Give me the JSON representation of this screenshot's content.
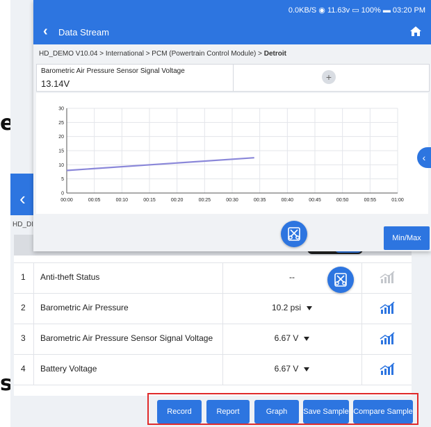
{
  "statusbar": {
    "text": "0.0KB/S  ◉  11.63v  ▭  100%  ▬  03:20 PM"
  },
  "title": "Data Stream",
  "breadcrumb": {
    "path": "HD_DEMO V10.04 > International > PCM (Powertrain Control Module) > ",
    "current": "Detroit"
  },
  "sensor": {
    "name": "Barometric Air Pressure Sensor Signal Voltage",
    "value": "13.14V",
    "add_label": "+"
  },
  "chart_data": {
    "type": "line",
    "title": "",
    "xlabel": "",
    "ylabel": "",
    "x_ticks": [
      "00:00",
      "00:05",
      "00:10",
      "00:15",
      "00:20",
      "00:25",
      "00:30",
      "00:35",
      "00:40",
      "00:45",
      "00:50",
      "00:55",
      "01:00"
    ],
    "y_ticks": [
      0,
      5,
      10,
      15,
      20,
      25,
      30
    ],
    "xlim": [
      0,
      60
    ],
    "ylim": [
      0,
      30
    ],
    "grid": true,
    "series": [
      {
        "color": "#8a87d9",
        "x": [
          0,
          34
        ],
        "y": [
          8.0,
          12.5
        ]
      }
    ]
  },
  "minmax_label": "Min/Max",
  "edge_letters": [
    "e",
    "s"
  ],
  "background": {
    "breadcrumb": "HD_DI",
    "rows": [
      {
        "num": "1",
        "name": "Anti-theft Status",
        "value": "--",
        "unit": "",
        "has_caret": false,
        "graph_active": false
      },
      {
        "num": "2",
        "name": "Barometric Air Pressure",
        "value": "10.2",
        "unit": "psi",
        "has_caret": true,
        "graph_active": true
      },
      {
        "num": "3",
        "name": "Barometric Air Pressure Sensor Signal Voltage",
        "value": "6.67",
        "unit": "V",
        "has_caret": true,
        "graph_active": true
      },
      {
        "num": "4",
        "name": "Battery Voltage",
        "value": "6.67",
        "unit": "V",
        "has_caret": true,
        "graph_active": true
      }
    ]
  },
  "actions": {
    "record": "Record",
    "report": "Report",
    "graph": "Graph",
    "save_sample": "Save Sample",
    "compare_sample": "Compare Sample"
  },
  "colors": {
    "primary": "#2d75e0",
    "series": "#8a87d9",
    "highlight_frame": "#e02a2a"
  }
}
